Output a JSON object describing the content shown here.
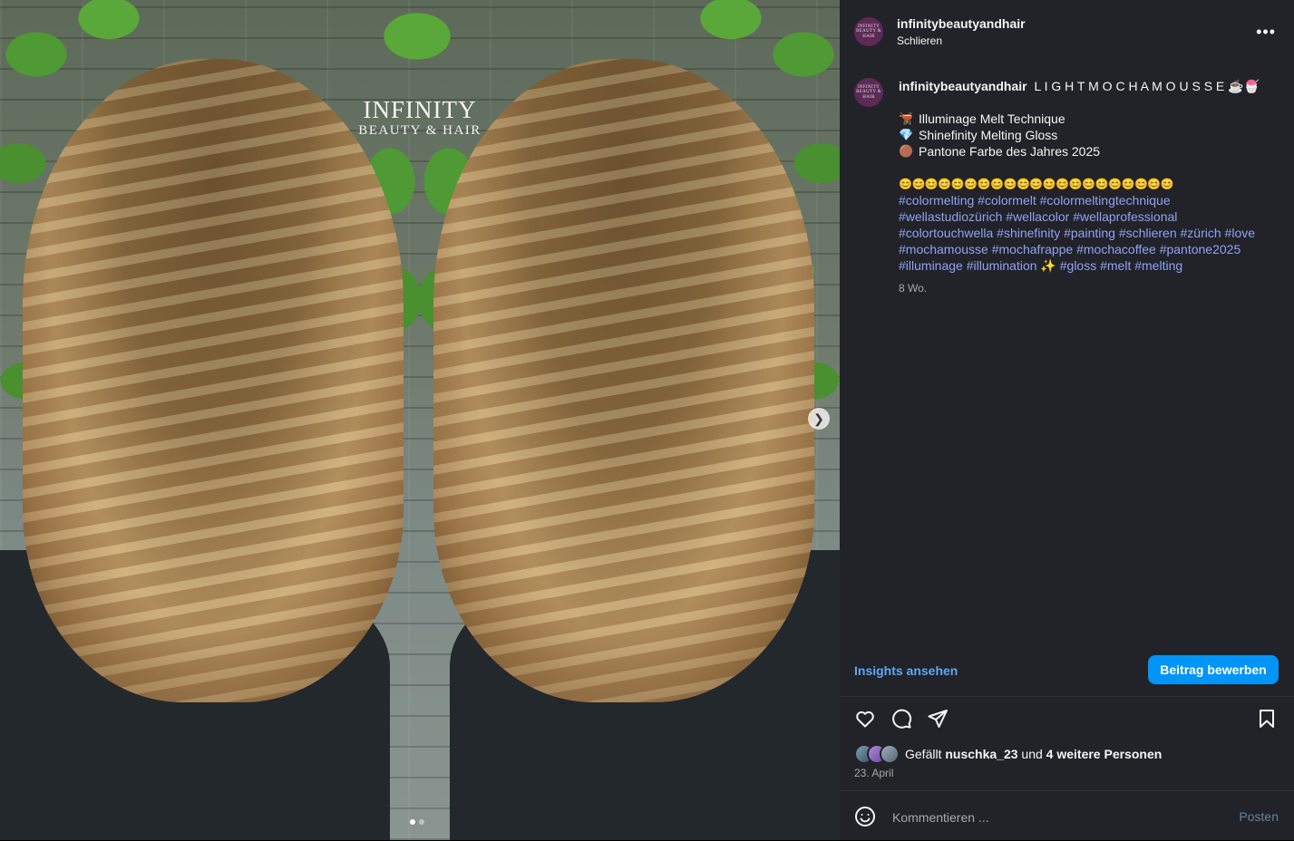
{
  "media": {
    "watermark_line1": "INFINITY",
    "watermark_line2": "BEAUTY & HAIR",
    "next_icon": "chevron-right-icon",
    "slide_count": 2,
    "active_slide": 1
  },
  "post": {
    "username": "infinitybeautyandhair",
    "location": "Schlieren",
    "avatar_text": "INFINITY BEAUTY & HAIR",
    "more_icon": "more-horizontal-icon",
    "more_label": "•••"
  },
  "caption": {
    "username": "infinitybeautyandhair",
    "title": "L I G H T M O C H A M O U S S E",
    "title_emojis": "☕🍧",
    "bullets": [
      {
        "icon": "🫕",
        "text": "Illuminage Melt Technique"
      },
      {
        "icon": "💎",
        "text": "Shinefinity Melting Gloss"
      },
      {
        "icon": "🟤",
        "text": "Pantone Farbe des Jahres 2025"
      }
    ],
    "emoji_row": "😊😊😊😊😊😊😊😊😊😊😊😊😊😊😊😊😊😊😊😊😊",
    "hashtag_lines": [
      "#colormelting #colormelt #colormeltingtechnique",
      "#wellastudiozürich #wellacolor #wellaprofessional",
      "#colortouchwella #shinefinity #painting #schlieren #zürich #love",
      "#mochamousse #mochafrappe #mochacoffee #pantone2025",
      "#illuminage #illumination ✨ #gloss #melt #melting"
    ],
    "time": "8 Wo."
  },
  "insights": {
    "link_label": "Insights ansehen",
    "edit_button_label": "Beitrag bewerben"
  },
  "actions": {
    "like_icon": "heart-icon",
    "comment_icon": "comment-icon",
    "share_icon": "send-icon",
    "save_icon": "bookmark-icon"
  },
  "likes": {
    "prefix": "Gefällt",
    "user": "nuschka_23",
    "middle": "und",
    "others": "4 weitere Personen"
  },
  "date": "23. April",
  "comment": {
    "placeholder": "Kommentieren ...",
    "post_label": "Posten",
    "emoji_icon": "smiley-icon"
  },
  "colors": {
    "panel_bg": "#212328",
    "link_blue": "#5fa6f6",
    "button_blue": "#0095f6",
    "hashtag": "#8fa2f3",
    "muted": "#a8a8a8"
  }
}
